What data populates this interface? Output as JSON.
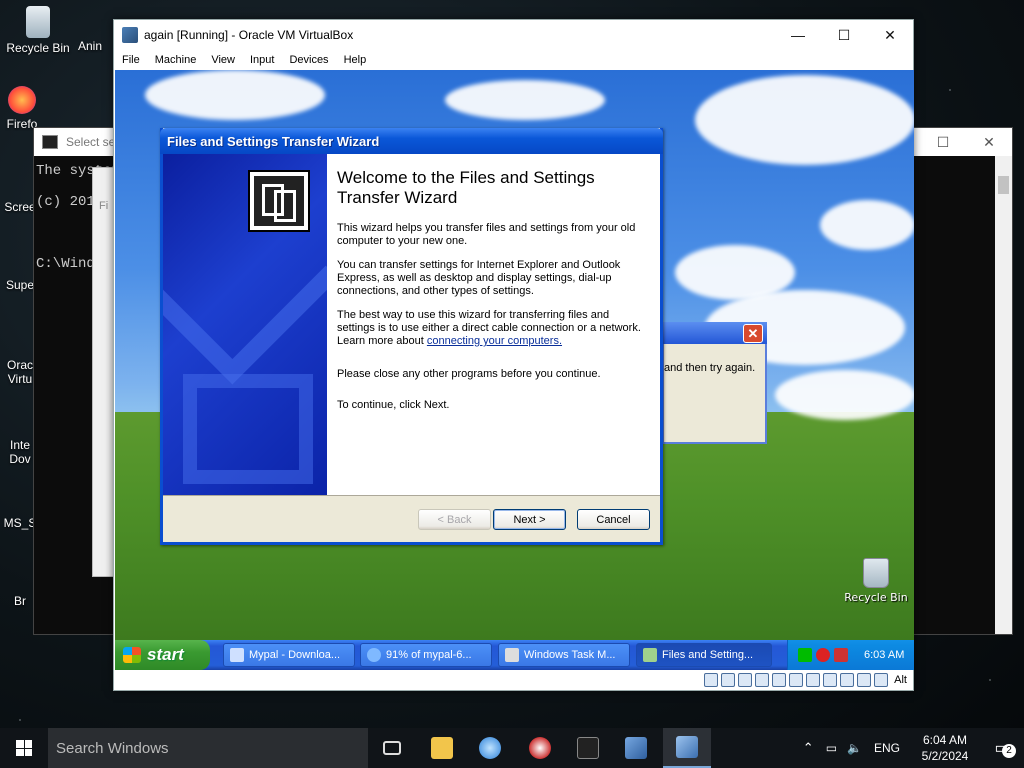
{
  "desktop": {
    "icons": [
      {
        "label": "Recycle Bin"
      },
      {
        "label": "Anin"
      },
      {
        "label": "Firefo"
      },
      {
        "label": "Scree"
      },
      {
        "label": "Supe"
      },
      {
        "label": "Orac Virtu"
      },
      {
        "label": "Inte Dov"
      },
      {
        "label": "MS_S"
      },
      {
        "label": "Br"
      }
    ]
  },
  "cmd": {
    "title": "Select set",
    "lines": [
      "The system",
      "(c) 2016",
      "C:\\Windo"
    ]
  },
  "background_window": {
    "fragment": "Fi"
  },
  "vbox": {
    "title": "again [Running] - Oracle VM VirtualBox",
    "menu": [
      "File",
      "Machine",
      "View",
      "Input",
      "Devices",
      "Help"
    ],
    "status_right": "Alt"
  },
  "xp": {
    "recycle_label": "Recycle Bin",
    "error_text": "and then try again.",
    "wizard": {
      "title": "Files and Settings Transfer Wizard",
      "heading": "Welcome to the Files and Settings Transfer Wizard",
      "p1": "This wizard helps you transfer files and settings from your old computer to your new one.",
      "p2": "You can transfer settings for Internet Explorer and Outlook Express, as well as desktop and display settings, dial-up connections, and other types of settings.",
      "p3_pre": "The best way to use this wizard for transferring files and settings is to use either a direct cable connection or a network. Learn more about ",
      "p3_link": "connecting your computers.",
      "p4": "Please close any other programs before you continue.",
      "p5": "To continue, click Next.",
      "back": "< Back",
      "next": "Next >",
      "cancel": "Cancel"
    },
    "taskbar": {
      "start": "start",
      "buttons": [
        "Mypal - Downloa...",
        "91% of mypal-6...",
        "Windows Task M...",
        "Files and Setting..."
      ],
      "clock": "6:03 AM"
    }
  },
  "win10": {
    "search_placeholder": "Search Windows",
    "lang": "ENG",
    "time": "6:04 AM",
    "date": "5/2/2024",
    "notifications": "2"
  }
}
